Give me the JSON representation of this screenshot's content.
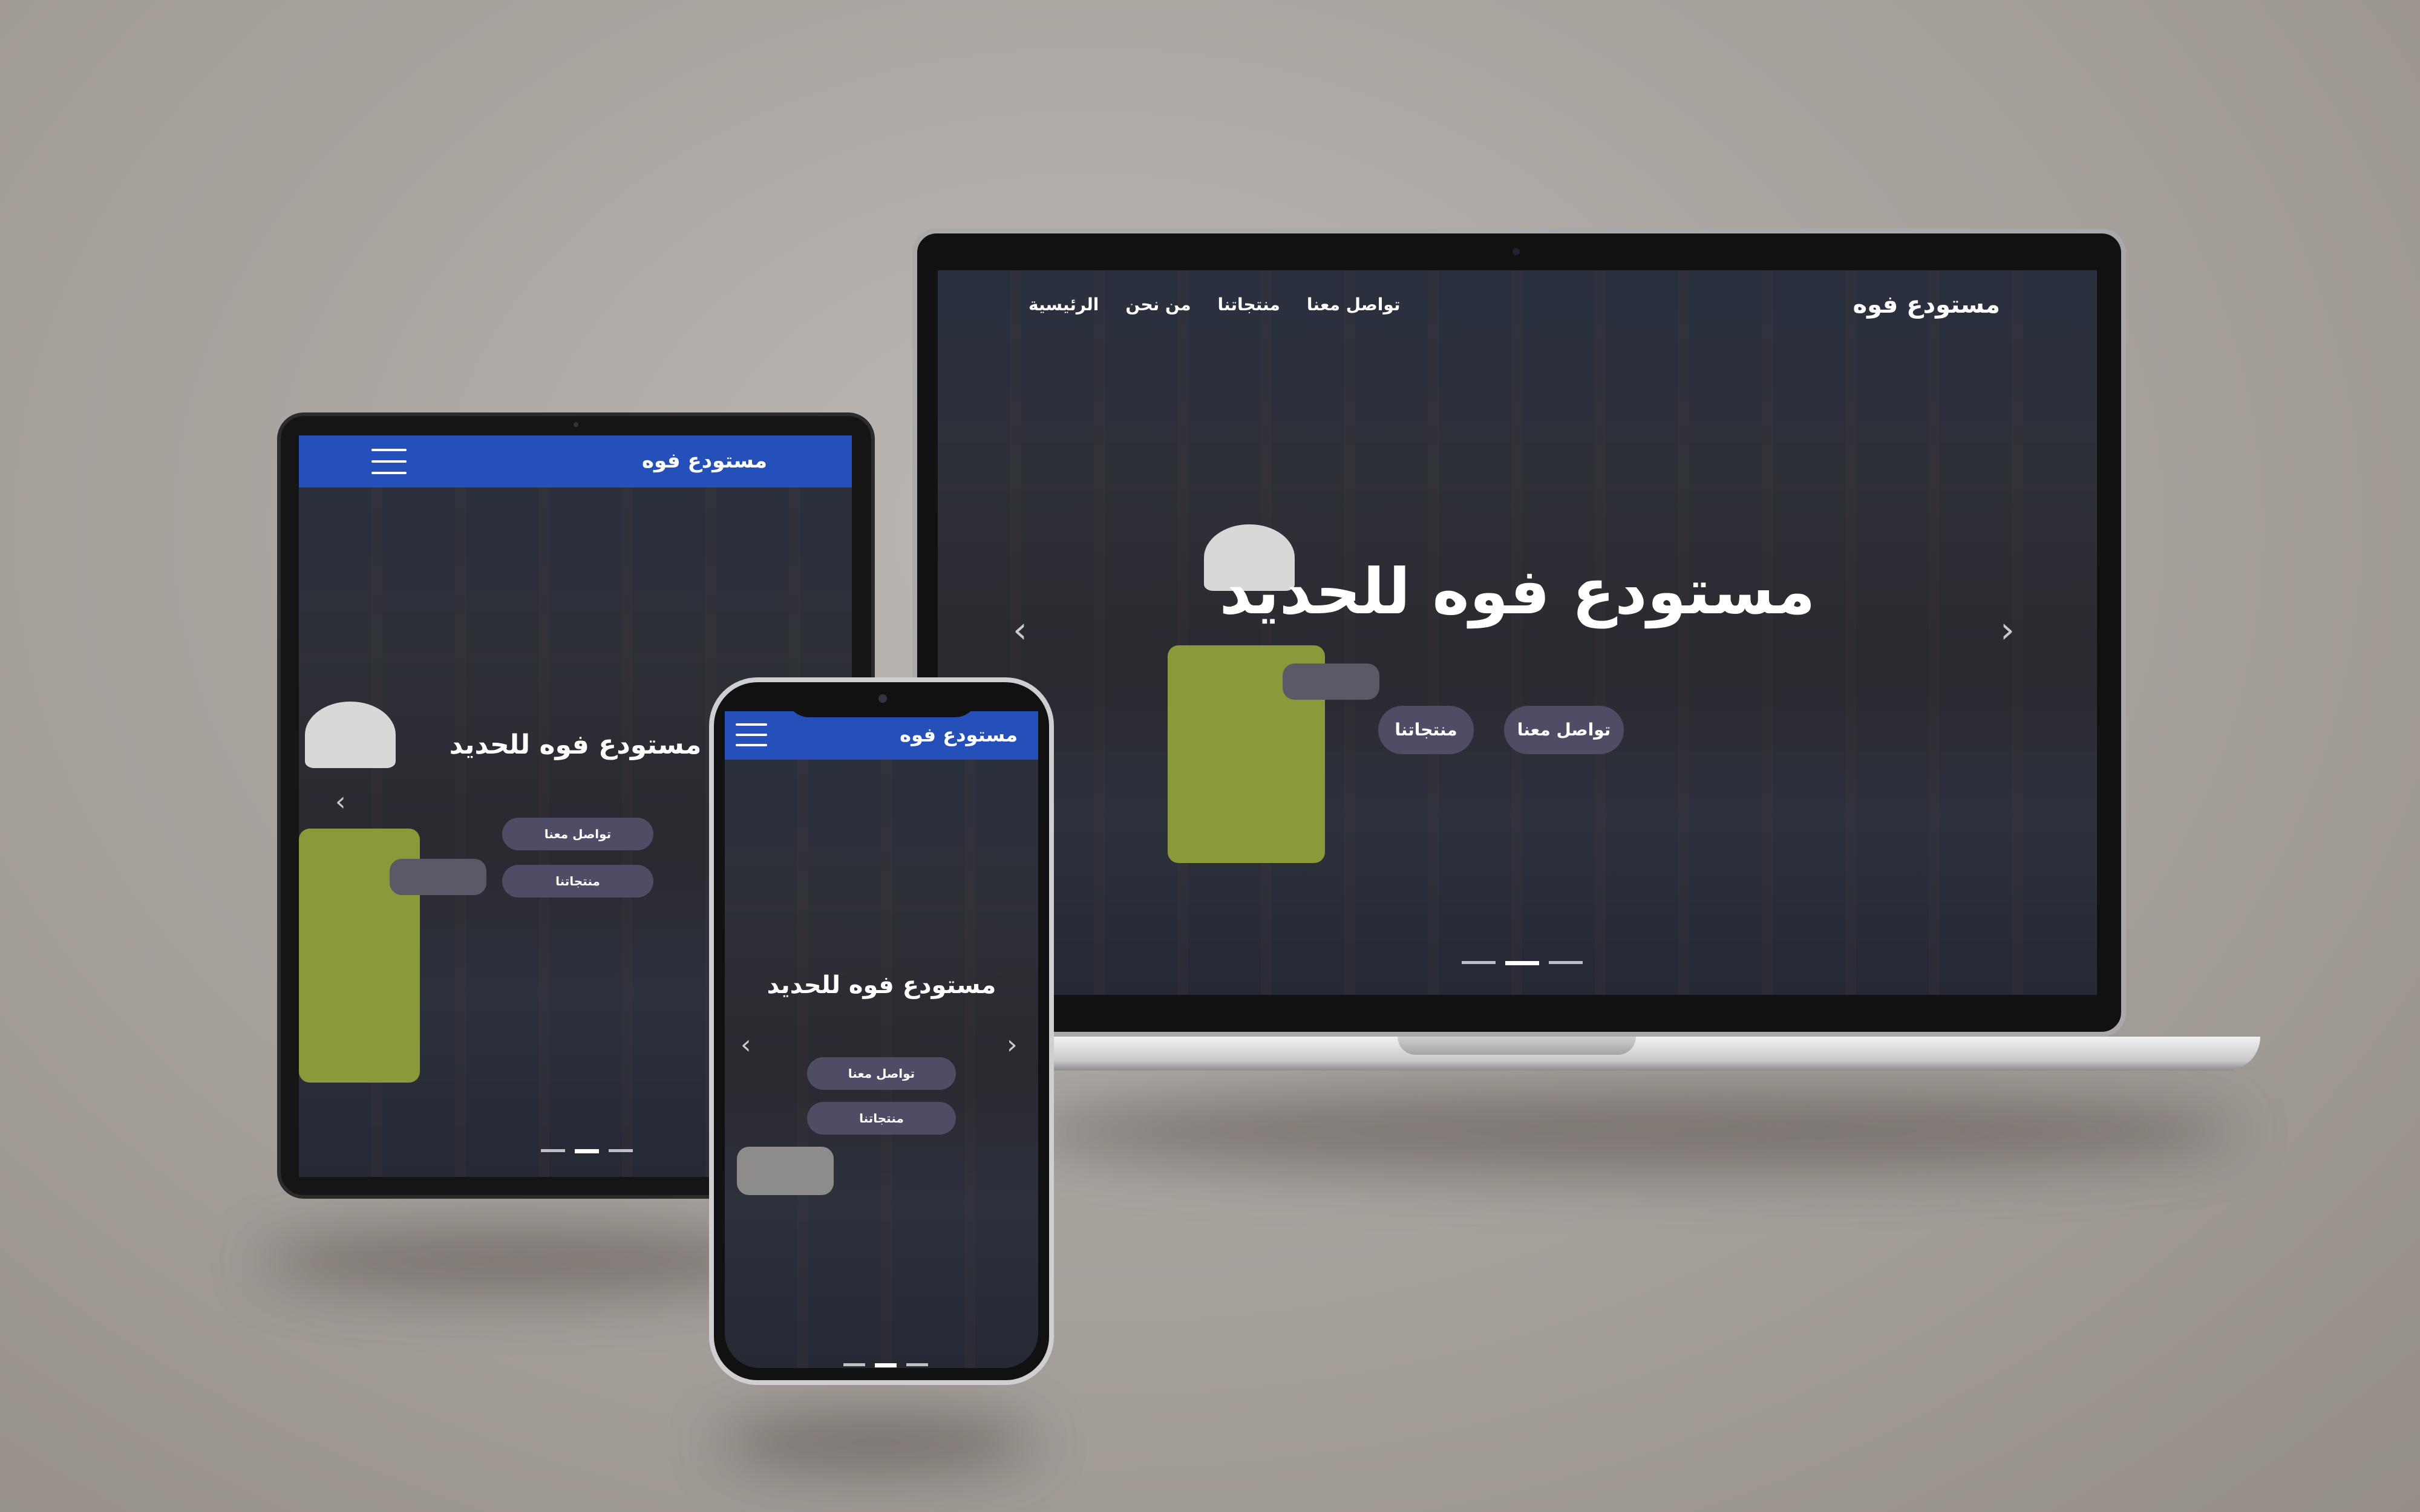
{
  "brand": "مستودع فوه",
  "hero_title": "مستودع فوه للحديد",
  "nav": [
    "الرئيسية",
    "من نحن",
    "منتجاتنا",
    "تواصل معنا"
  ],
  "buttons": {
    "contact": "تواصل معنا",
    "products": "منتجاتنا"
  },
  "icons": {
    "prev": "chevron-left-icon",
    "next": "chevron-right-icon",
    "menu": "hamburger-menu-icon"
  },
  "carousel": {
    "slides": 3,
    "active_slide": 2
  },
  "colors": {
    "nav_bar": "#2550b9",
    "button": "#4f4c66",
    "text": "#ffffff"
  }
}
